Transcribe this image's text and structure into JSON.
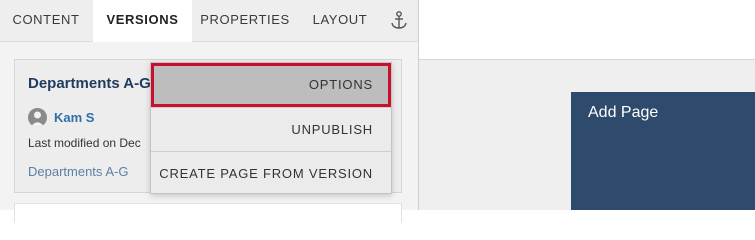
{
  "tabs": [
    {
      "label": "CONTENT"
    },
    {
      "label": "VERSIONS",
      "active": true
    },
    {
      "label": "PROPERTIES"
    },
    {
      "label": "LAYOUT"
    }
  ],
  "anchor_icon": "anchor-icon",
  "version_card": {
    "title": "Departments A-G",
    "author": "Kam S",
    "modified": "Last modified on Dec",
    "link": "Departments A-G"
  },
  "dropdown": {
    "items": [
      {
        "label": "OPTIONS"
      },
      {
        "label": "UNPUBLISH"
      },
      {
        "label": "CREATE PAGE FROM VERSION"
      }
    ],
    "highlight_color": "#c8102e"
  },
  "preview": {
    "add_page_label": "Add Page",
    "tile_color": "#2e4a6d"
  }
}
